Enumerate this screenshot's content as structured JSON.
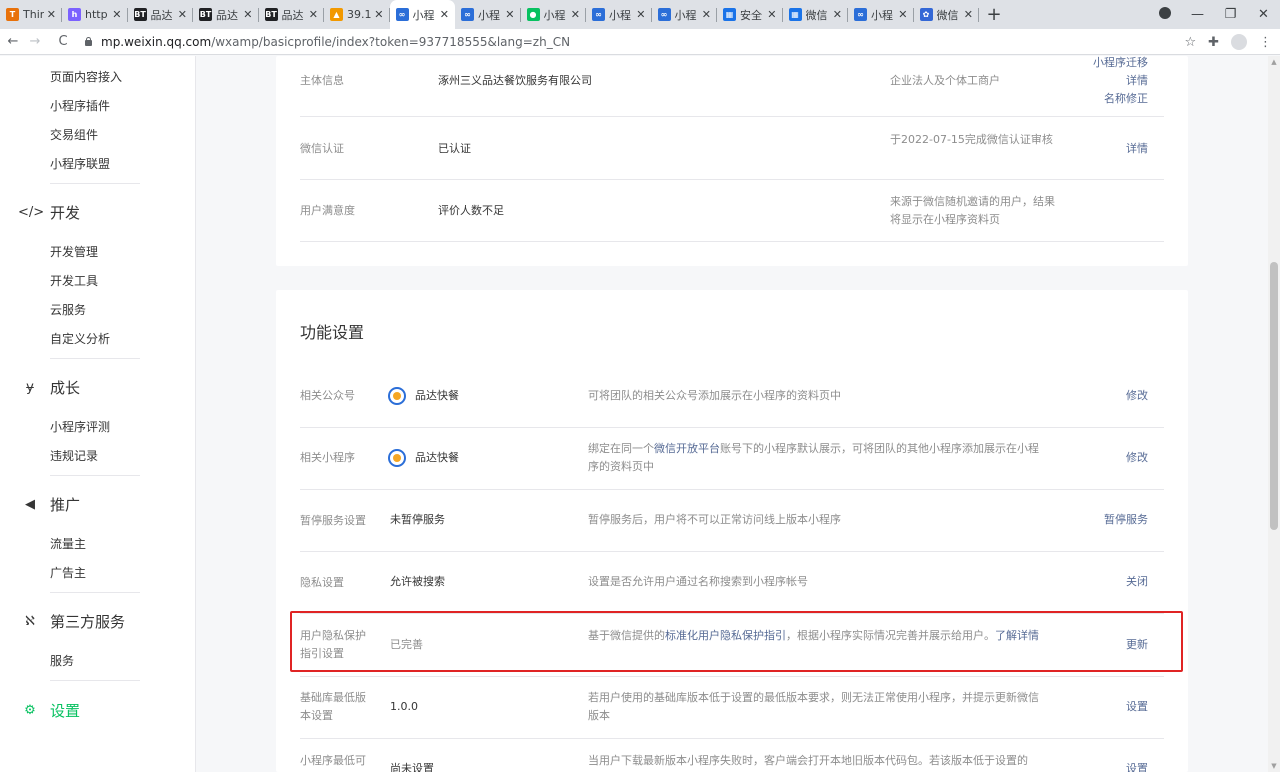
{
  "browser": {
    "tabs": [
      {
        "title": "Thin",
        "color": "#e8710a",
        "glyph": "T"
      },
      {
        "title": "http",
        "color": "#7b61ff",
        "glyph": "h"
      },
      {
        "title": "品达",
        "color": "#202124",
        "glyph": "BT"
      },
      {
        "title": "品达",
        "color": "#202124",
        "glyph": "BT"
      },
      {
        "title": "品达",
        "color": "#202124",
        "glyph": "BT"
      },
      {
        "title": "39.1",
        "color": "#f29900",
        "glyph": "▲"
      },
      {
        "title": "小程",
        "color": "#2b6ed8",
        "glyph": "∞",
        "active": true
      },
      {
        "title": "小程",
        "color": "#2b6ed8",
        "glyph": "∞"
      },
      {
        "title": "小程",
        "color": "#07c160",
        "glyph": "●"
      },
      {
        "title": "小程",
        "color": "#2b6ed8",
        "glyph": "∞"
      },
      {
        "title": "小程",
        "color": "#2b6ed8",
        "glyph": "∞"
      },
      {
        "title": "安全",
        "color": "#1a73e8",
        "glyph": "▦"
      },
      {
        "title": "微信",
        "color": "#1a73e8",
        "glyph": "▦"
      },
      {
        "title": "小程",
        "color": "#2b6ed8",
        "glyph": "∞"
      },
      {
        "title": "微信",
        "color": "#3367d6",
        "glyph": "✿"
      }
    ],
    "new_tab_glyph": "+",
    "url_host": "mp.weixin.qq.com",
    "url_path": "/wxamp/basicprofile/index?token=937718555&lang=zh_CN"
  },
  "sidebar": {
    "items_top": [
      "页面内容接入",
      "小程序插件",
      "交易组件",
      "小程序联盟"
    ],
    "dev": {
      "title": "开发",
      "items": [
        "开发管理",
        "开发工具",
        "云服务",
        "自定义分析"
      ]
    },
    "growth": {
      "title": "成长",
      "items": [
        "小程序评测",
        "违规记录"
      ]
    },
    "promo": {
      "title": "推广",
      "items": [
        "流量主",
        "广告主"
      ]
    },
    "third": {
      "title": "第三方服务",
      "items": [
        "服务"
      ]
    },
    "settings": {
      "title": "设置"
    }
  },
  "account_info": {
    "rows": [
      {
        "label": "主体信息",
        "value": "涿州三义品达餐饮服务有限公司",
        "desc": "企业法人及个体工商户",
        "actions": [
          "小程序迁移",
          "详情",
          "名称修正"
        ]
      },
      {
        "label": "微信认证",
        "value": "已认证",
        "desc": "于2022-07-15完成微信认证审核",
        "actions": [
          "详情"
        ]
      },
      {
        "label": "用户满意度",
        "value": "评价人数不足",
        "desc": "来源于微信随机邀请的用户，结果将显示在小程序资料页",
        "actions": []
      }
    ]
  },
  "features": {
    "title": "功能设置",
    "rows": [
      {
        "label": "相关公众号",
        "value": "品达快餐",
        "logo": true,
        "desc": "可将团队的相关公众号添加展示在小程序的资料页中",
        "action": "修改"
      },
      {
        "label": "相关小程序",
        "value": "品达快餐",
        "logo": true,
        "desc_pre": "绑定在同一个",
        "desc_link": "微信开放平台",
        "desc_post": "账号下的小程序默认展示，可将团队的其他小程序添加展示在小程序的资料页中",
        "action": "修改"
      },
      {
        "label": "暂停服务设置",
        "value": "未暂停服务",
        "desc": "暂停服务后，用户将不可以正常访问线上版本小程序",
        "action": "暂停服务"
      },
      {
        "label": "隐私设置",
        "value": "允许被搜索",
        "desc": "设置是否允许用户通过名称搜索到小程序帐号",
        "action": "关闭"
      },
      {
        "label": "用户隐私保护指引设置",
        "value": "已完善",
        "desc_pre": "基于微信提供的",
        "desc_link": "标准化用户隐私保护指引",
        "desc_mid": "，根据小程序实际情况完善并展示给用户。",
        "desc_link2": "了解详情",
        "action": "更新"
      },
      {
        "label": "基础库最低版本设置",
        "value": "1.0.0",
        "desc": "若用户使用的基础库版本低于设置的最低版本要求，则无法正常使用小程序，并提示更新微信版本",
        "action": "设置"
      },
      {
        "label": "小程序最低可",
        "value": "尚未设置",
        "desc": "当用户下载最新版本小程序失败时，客户端会打开本地旧版本代码包。若该版本低于设置的",
        "action": "设置"
      }
    ]
  }
}
